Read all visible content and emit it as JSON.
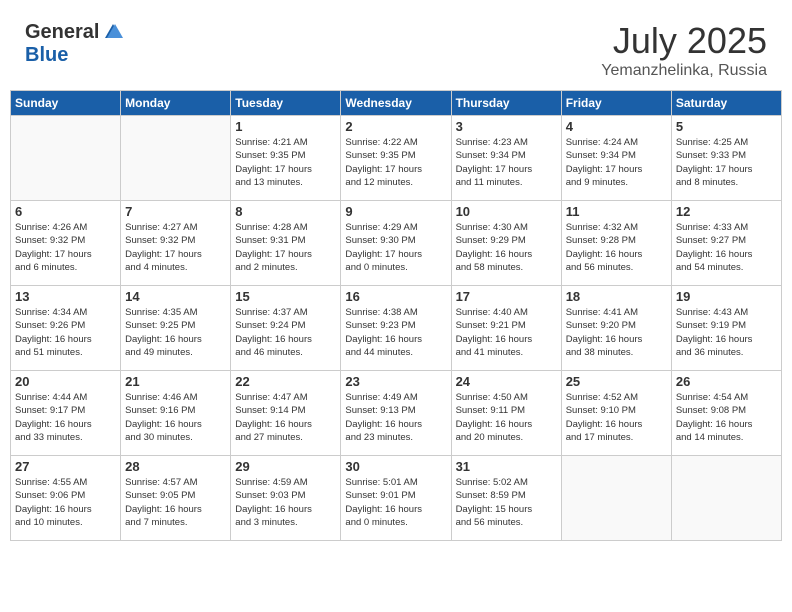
{
  "header": {
    "logo_general": "General",
    "logo_blue": "Blue",
    "month_title": "July 2025",
    "location": "Yemanzhelinka, Russia"
  },
  "days_of_week": [
    "Sunday",
    "Monday",
    "Tuesday",
    "Wednesday",
    "Thursday",
    "Friday",
    "Saturday"
  ],
  "weeks": [
    [
      {
        "day": "",
        "info": ""
      },
      {
        "day": "",
        "info": ""
      },
      {
        "day": "1",
        "info": "Sunrise: 4:21 AM\nSunset: 9:35 PM\nDaylight: 17 hours\nand 13 minutes."
      },
      {
        "day": "2",
        "info": "Sunrise: 4:22 AM\nSunset: 9:35 PM\nDaylight: 17 hours\nand 12 minutes."
      },
      {
        "day": "3",
        "info": "Sunrise: 4:23 AM\nSunset: 9:34 PM\nDaylight: 17 hours\nand 11 minutes."
      },
      {
        "day": "4",
        "info": "Sunrise: 4:24 AM\nSunset: 9:34 PM\nDaylight: 17 hours\nand 9 minutes."
      },
      {
        "day": "5",
        "info": "Sunrise: 4:25 AM\nSunset: 9:33 PM\nDaylight: 17 hours\nand 8 minutes."
      }
    ],
    [
      {
        "day": "6",
        "info": "Sunrise: 4:26 AM\nSunset: 9:32 PM\nDaylight: 17 hours\nand 6 minutes."
      },
      {
        "day": "7",
        "info": "Sunrise: 4:27 AM\nSunset: 9:32 PM\nDaylight: 17 hours\nand 4 minutes."
      },
      {
        "day": "8",
        "info": "Sunrise: 4:28 AM\nSunset: 9:31 PM\nDaylight: 17 hours\nand 2 minutes."
      },
      {
        "day": "9",
        "info": "Sunrise: 4:29 AM\nSunset: 9:30 PM\nDaylight: 17 hours\nand 0 minutes."
      },
      {
        "day": "10",
        "info": "Sunrise: 4:30 AM\nSunset: 9:29 PM\nDaylight: 16 hours\nand 58 minutes."
      },
      {
        "day": "11",
        "info": "Sunrise: 4:32 AM\nSunset: 9:28 PM\nDaylight: 16 hours\nand 56 minutes."
      },
      {
        "day": "12",
        "info": "Sunrise: 4:33 AM\nSunset: 9:27 PM\nDaylight: 16 hours\nand 54 minutes."
      }
    ],
    [
      {
        "day": "13",
        "info": "Sunrise: 4:34 AM\nSunset: 9:26 PM\nDaylight: 16 hours\nand 51 minutes."
      },
      {
        "day": "14",
        "info": "Sunrise: 4:35 AM\nSunset: 9:25 PM\nDaylight: 16 hours\nand 49 minutes."
      },
      {
        "day": "15",
        "info": "Sunrise: 4:37 AM\nSunset: 9:24 PM\nDaylight: 16 hours\nand 46 minutes."
      },
      {
        "day": "16",
        "info": "Sunrise: 4:38 AM\nSunset: 9:23 PM\nDaylight: 16 hours\nand 44 minutes."
      },
      {
        "day": "17",
        "info": "Sunrise: 4:40 AM\nSunset: 9:21 PM\nDaylight: 16 hours\nand 41 minutes."
      },
      {
        "day": "18",
        "info": "Sunrise: 4:41 AM\nSunset: 9:20 PM\nDaylight: 16 hours\nand 38 minutes."
      },
      {
        "day": "19",
        "info": "Sunrise: 4:43 AM\nSunset: 9:19 PM\nDaylight: 16 hours\nand 36 minutes."
      }
    ],
    [
      {
        "day": "20",
        "info": "Sunrise: 4:44 AM\nSunset: 9:17 PM\nDaylight: 16 hours\nand 33 minutes."
      },
      {
        "day": "21",
        "info": "Sunrise: 4:46 AM\nSunset: 9:16 PM\nDaylight: 16 hours\nand 30 minutes."
      },
      {
        "day": "22",
        "info": "Sunrise: 4:47 AM\nSunset: 9:14 PM\nDaylight: 16 hours\nand 27 minutes."
      },
      {
        "day": "23",
        "info": "Sunrise: 4:49 AM\nSunset: 9:13 PM\nDaylight: 16 hours\nand 23 minutes."
      },
      {
        "day": "24",
        "info": "Sunrise: 4:50 AM\nSunset: 9:11 PM\nDaylight: 16 hours\nand 20 minutes."
      },
      {
        "day": "25",
        "info": "Sunrise: 4:52 AM\nSunset: 9:10 PM\nDaylight: 16 hours\nand 17 minutes."
      },
      {
        "day": "26",
        "info": "Sunrise: 4:54 AM\nSunset: 9:08 PM\nDaylight: 16 hours\nand 14 minutes."
      }
    ],
    [
      {
        "day": "27",
        "info": "Sunrise: 4:55 AM\nSunset: 9:06 PM\nDaylight: 16 hours\nand 10 minutes."
      },
      {
        "day": "28",
        "info": "Sunrise: 4:57 AM\nSunset: 9:05 PM\nDaylight: 16 hours\nand 7 minutes."
      },
      {
        "day": "29",
        "info": "Sunrise: 4:59 AM\nSunset: 9:03 PM\nDaylight: 16 hours\nand 3 minutes."
      },
      {
        "day": "30",
        "info": "Sunrise: 5:01 AM\nSunset: 9:01 PM\nDaylight: 16 hours\nand 0 minutes."
      },
      {
        "day": "31",
        "info": "Sunrise: 5:02 AM\nSunset: 8:59 PM\nDaylight: 15 hours\nand 56 minutes."
      },
      {
        "day": "",
        "info": ""
      },
      {
        "day": "",
        "info": ""
      }
    ]
  ]
}
